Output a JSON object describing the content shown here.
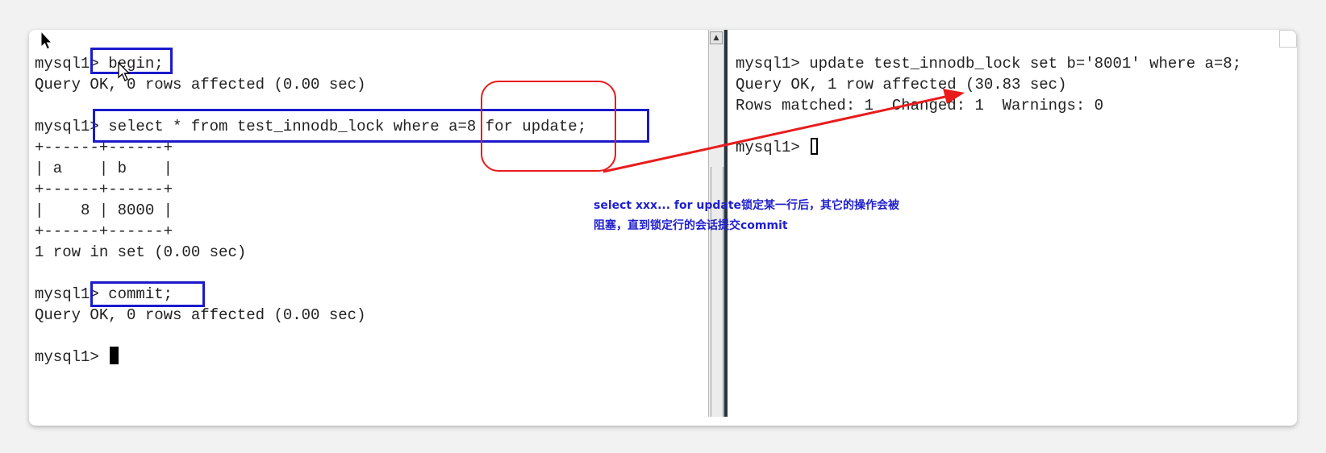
{
  "left_terminal": {
    "prompt_begin": "mysql1> ",
    "cmd_begin": "begin;",
    "result_begin": "Query OK, 0 rows affected (0.00 sec)",
    "prompt_select": "mysql1> ",
    "cmd_select": "select * from test_innodb_lock where a=8 for update;",
    "table_border_1": "+------+------+",
    "table_header": "| a    | b    |",
    "table_border_2": "+------+------+",
    "table_row": "|    8 | 8000 |",
    "table_border_3": "+------+------+",
    "result_select": "1 row in set (0.00 sec)",
    "prompt_commit": "mysql1> ",
    "cmd_commit": "commit;",
    "result_commit": "Query OK, 0 rows affected (0.00 sec)",
    "prompt_final": "mysql1> "
  },
  "right_terminal": {
    "prompt_update": "mysql1> ",
    "cmd_update": "update test_innodb_lock set b='8001' where a=8;",
    "result_update": "Query OK, 1 row affected (30.83 sec)",
    "result_rows": "Rows matched: 1  Changed: 1  Warnings: 0",
    "prompt_final": "mysql1> "
  },
  "annotation": {
    "line1": "select xxx... for update锁定某一行后，其它的操作会被",
    "line2": "阻塞，直到锁定行的会话提交commit"
  },
  "colors": {
    "highlight_box": "#1a1acc",
    "arrow": "#e81c1c",
    "note_text": "#1f1fcc"
  },
  "icons": {
    "mouse_pointer": "mouse-pointer-icon",
    "scroll_up": "scroll-up-arrow-icon"
  }
}
